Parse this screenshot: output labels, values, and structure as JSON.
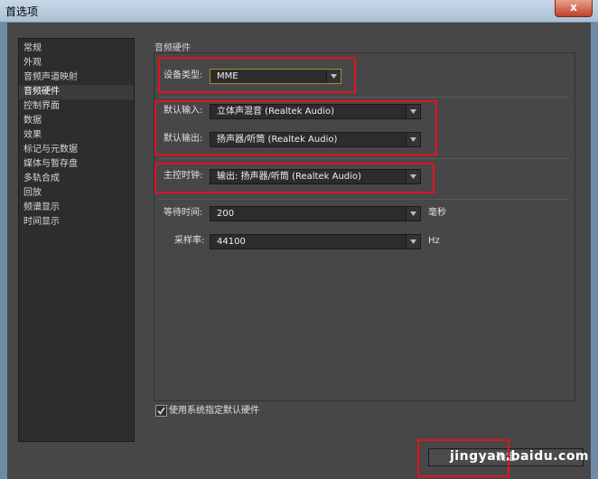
{
  "window": {
    "title": "首选项",
    "close_glyph": "x"
  },
  "sidebar": {
    "items": [
      {
        "label": "常规"
      },
      {
        "label": "外观"
      },
      {
        "label": "音频声道映射"
      },
      {
        "label": "音频硬件",
        "selected": true
      },
      {
        "label": "控制界面"
      },
      {
        "label": "数据"
      },
      {
        "label": "效果"
      },
      {
        "label": "标记与元数据"
      },
      {
        "label": "媒体与暂存盘"
      },
      {
        "label": "多轨合成"
      },
      {
        "label": "回放"
      },
      {
        "label": "频谱显示"
      },
      {
        "label": "时间显示"
      }
    ]
  },
  "section": {
    "title": "音频硬件"
  },
  "device_type": {
    "label": "设备类型:",
    "value": "MME"
  },
  "default_input": {
    "label": "默认输入:",
    "value": "立体声混音 (Realtek Audio)"
  },
  "default_output": {
    "label": "默认输出:",
    "value": "扬声器/听筒 (Realtek Audio)"
  },
  "master_clock": {
    "label": "主控时钟:",
    "value": "输出: 扬声器/听筒 (Realtek Audio)"
  },
  "latency": {
    "label": "等待时间:",
    "value": "200",
    "unit": "毫秒"
  },
  "sample_rate": {
    "label": "采样率:",
    "value": "44100",
    "unit": "Hz"
  },
  "use_system_default": {
    "label": "使用系统指定默认硬件",
    "checked": true
  },
  "ok_button": {
    "label": "确定"
  },
  "watermark": {
    "text": "jingyan.baidu.com"
  },
  "colors": {
    "highlight_box": "#e3121e",
    "panel_bg": "#474747",
    "dropdown_bg": "#2c2c2c"
  }
}
